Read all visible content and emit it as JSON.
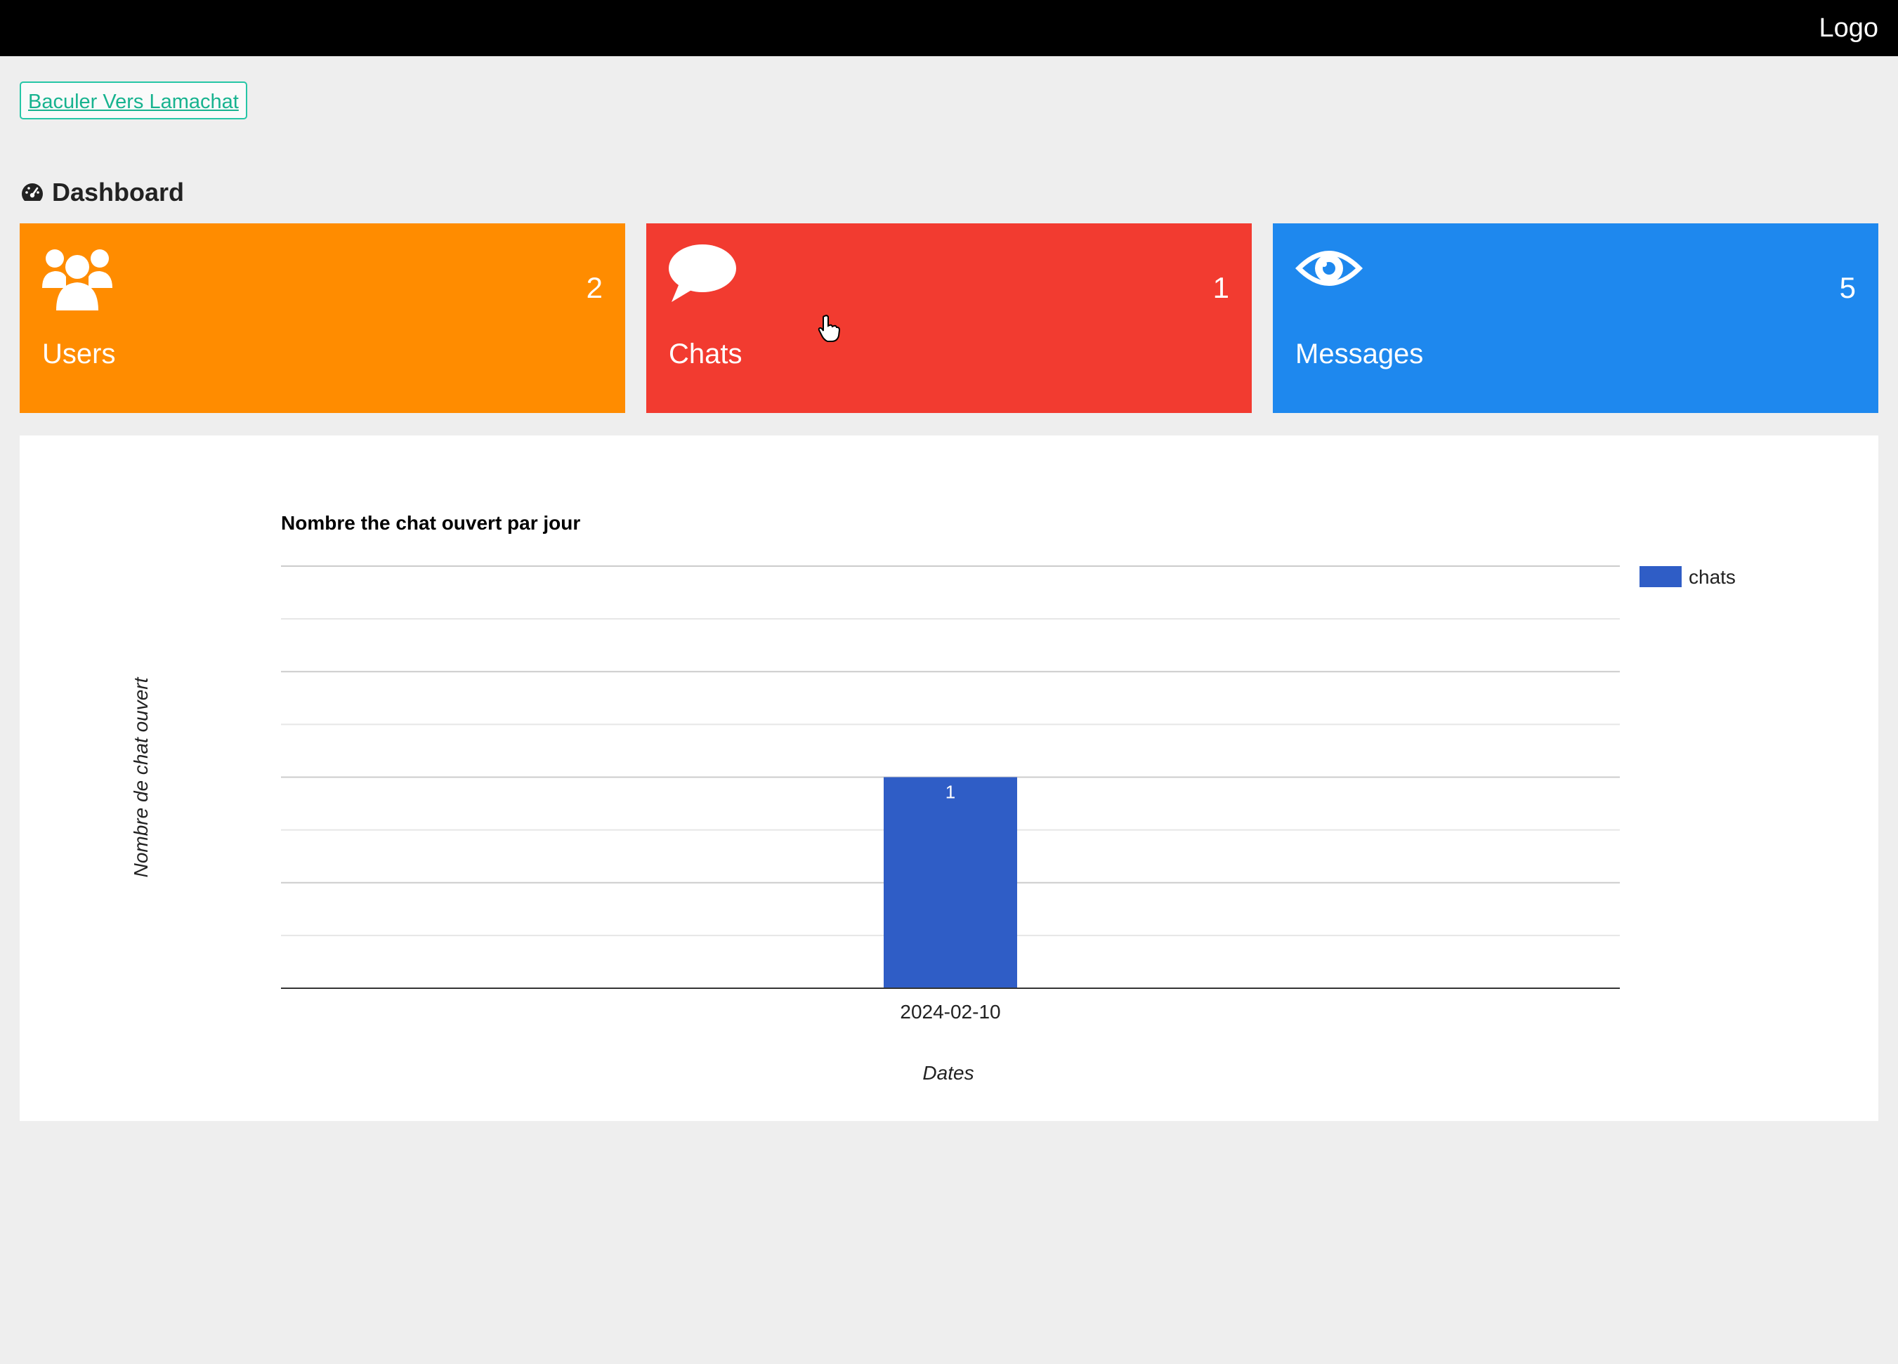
{
  "header": {
    "logo_text": "Logo"
  },
  "switch_button": {
    "label": "Baculer Vers Lamachat"
  },
  "dashboard": {
    "title": "Dashboard",
    "icon": "tachometer-icon"
  },
  "stat_cards": [
    {
      "label": "Users",
      "count": "2",
      "icon": "users-icon",
      "color": "#ff8c00"
    },
    {
      "label": "Chats",
      "count": "1",
      "icon": "chat-bubble-icon",
      "color": "#f23b30"
    },
    {
      "label": "Messages",
      "count": "5",
      "icon": "eye-icon",
      "color": "#1e88ee"
    }
  ],
  "chart_data": {
    "type": "bar",
    "title": "Nombre the chat ouvert par jour",
    "xlabel": "Dates",
    "ylabel": "Nombre de chat ouvert",
    "categories": [
      "2024-02-10"
    ],
    "series": [
      {
        "name": "chats",
        "values": [
          1
        ],
        "color": "#2f5dc6",
        "data_labels": [
          "1"
        ]
      }
    ],
    "ylim": [
      0,
      2
    ],
    "grid": true,
    "legend": "top-right"
  }
}
